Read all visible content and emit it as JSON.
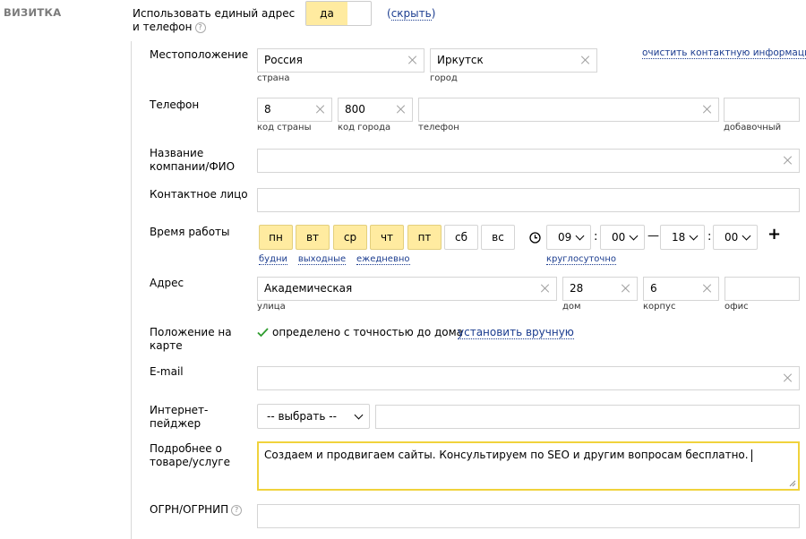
{
  "section": {
    "title": "ВИЗИТКА"
  },
  "unified": {
    "label_line1": "Использовать единый адрес",
    "label_line2": "и телефон",
    "toggle_value": "да",
    "hide_link": "скрыть",
    "paren_open": "(",
    "paren_close": ")"
  },
  "location": {
    "label": "Местоположение",
    "country_value": "Россия",
    "country_caption": "страна",
    "city_value": "Иркутск",
    "city_caption": "город",
    "clear_link": "очистить контактную информацию"
  },
  "phone": {
    "label": "Телефон",
    "country_code": "8",
    "country_code_caption": "код страны",
    "city_code": "800",
    "city_code_caption": "код города",
    "number": "",
    "number_caption": "телефон",
    "ext": "",
    "ext_caption": "добавочный"
  },
  "company": {
    "label_line1": "Название",
    "label_line2": "компании/ФИО",
    "value": ""
  },
  "contact_person": {
    "label": "Контактное лицо",
    "value": ""
  },
  "hours": {
    "label": "Время работы",
    "days": [
      {
        "label": "пн",
        "active": true
      },
      {
        "label": "вт",
        "active": true
      },
      {
        "label": "ср",
        "active": true
      },
      {
        "label": "чт",
        "active": true
      },
      {
        "label": "пт",
        "active": true
      },
      {
        "label": "сб",
        "active": false
      },
      {
        "label": "вс",
        "active": false
      }
    ],
    "presets": [
      "будни",
      "выходные",
      "ежедневно"
    ],
    "from_hour": "09",
    "from_min": "00",
    "dash": "—",
    "to_hour": "18",
    "to_min": "00",
    "colon": ":",
    "round_clock": "круглосуточно",
    "add": "+"
  },
  "address": {
    "label": "Адрес",
    "street": "Академическая",
    "street_caption": "улица",
    "house": "28",
    "house_caption": "дом",
    "building": "6",
    "building_caption": "корпус",
    "office": "",
    "office_caption": "офис"
  },
  "map": {
    "label_line1": "Положение на",
    "label_line2": "карте",
    "status": "определено с точностью до дома",
    "manual_link": "установить вручную"
  },
  "email": {
    "label": "E-mail",
    "value": ""
  },
  "messenger": {
    "label_line1": "Интернет-",
    "label_line2": "пейджер",
    "select_value": "-- выбрать --",
    "value": ""
  },
  "details": {
    "label_line1": "Подробнее о",
    "label_line2": "товаре/услуге",
    "value": "Создаем и продвигаем сайты. Консультируем по SEO и другим вопросам бесплатно."
  },
  "ogrn": {
    "label": "ОГРН/ОГРНИП",
    "value": ""
  },
  "colors": {
    "accent_yellow": "#ffeba0",
    "focus_border": "#f0d23c",
    "link": "#1b3c8f",
    "check": "#2e9c2e"
  }
}
